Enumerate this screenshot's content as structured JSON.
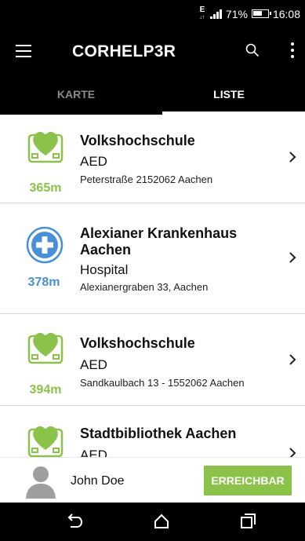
{
  "status_bar": {
    "network": "E",
    "battery": "71%",
    "time": "16:08"
  },
  "app": {
    "title": "CORHELP3R"
  },
  "tabs": [
    {
      "label": "KARTE",
      "active": false
    },
    {
      "label": "LISTE",
      "active": true
    }
  ],
  "list": [
    {
      "icon": "aed-heart-icon",
      "distance": "365m",
      "name": "Volkshochschule",
      "type": "AED",
      "address": "Peterstraße 2152062 Aachen"
    },
    {
      "icon": "hospital-cross-icon",
      "distance": "378m",
      "name": "Alexianer Krankenhaus Aachen",
      "type": "Hospital",
      "address": "Alexianergraben 33, Aachen"
    },
    {
      "icon": "aed-heart-icon",
      "distance": "394m",
      "name": "Volkshochschule",
      "type": "AED",
      "address": "Sandkaulbach 13 - 1552062 Aachen"
    },
    {
      "icon": "aed-heart-icon",
      "distance": "",
      "name": "Stadtbibliothek Aachen",
      "type": "AED",
      "address": ""
    }
  ],
  "user": {
    "name": "John Doe",
    "status_button": "ERREICHBAR"
  },
  "colors": {
    "aed_green": "#8bc34a",
    "hospital_blue": "#4a90d9",
    "bar_black": "#000000"
  }
}
